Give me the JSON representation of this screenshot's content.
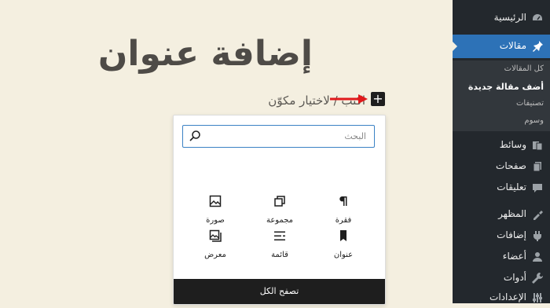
{
  "editor": {
    "post_title": "إضافة عنوان",
    "block_placeholder": "اكتب / لاختيار مكوّن",
    "inserter_toggle_label": "+"
  },
  "inserter": {
    "search_placeholder": "البحث",
    "blocks": [
      {
        "label": "فقرة",
        "icon": "paragraph-icon"
      },
      {
        "label": "مجموعة",
        "icon": "group-icon"
      },
      {
        "label": "صورة",
        "icon": "image-icon"
      },
      {
        "label": "عنوان",
        "icon": "heading-bookmark-icon"
      },
      {
        "label": "قائمة",
        "icon": "list-icon"
      },
      {
        "label": "معرض",
        "icon": "gallery-icon"
      }
    ],
    "browse_all_label": "تصفح الكل"
  },
  "sidebar": {
    "items": [
      {
        "label": "الرئيسية",
        "icon": "dashboard-icon"
      },
      {
        "label": "مقالات",
        "icon": "pin-icon",
        "active": true
      },
      {
        "label": "وسائط",
        "icon": "media-icon"
      },
      {
        "label": "صفحات",
        "icon": "pages-icon"
      },
      {
        "label": "تعليقات",
        "icon": "comments-icon"
      },
      {
        "label": "المظهر",
        "icon": "appearance-icon"
      },
      {
        "label": "إضافات",
        "icon": "plugins-icon"
      },
      {
        "label": "أعضاء",
        "icon": "users-icon"
      },
      {
        "label": "أدوات",
        "icon": "tools-icon"
      },
      {
        "label": "الإعدادات",
        "icon": "settings-icon"
      }
    ],
    "submenu": [
      {
        "label": "كل المقالات"
      },
      {
        "label": "أضف مقالة جديدة",
        "current": true
      },
      {
        "label": "تصنيفات"
      },
      {
        "label": "وسوم"
      }
    ]
  },
  "colors": {
    "editor_background": "#f4efe0",
    "sidebar_background": "#23282d",
    "active_menu": "#2d72b7",
    "search_focus": "#3b82c4",
    "arrow": "#e0191b"
  }
}
